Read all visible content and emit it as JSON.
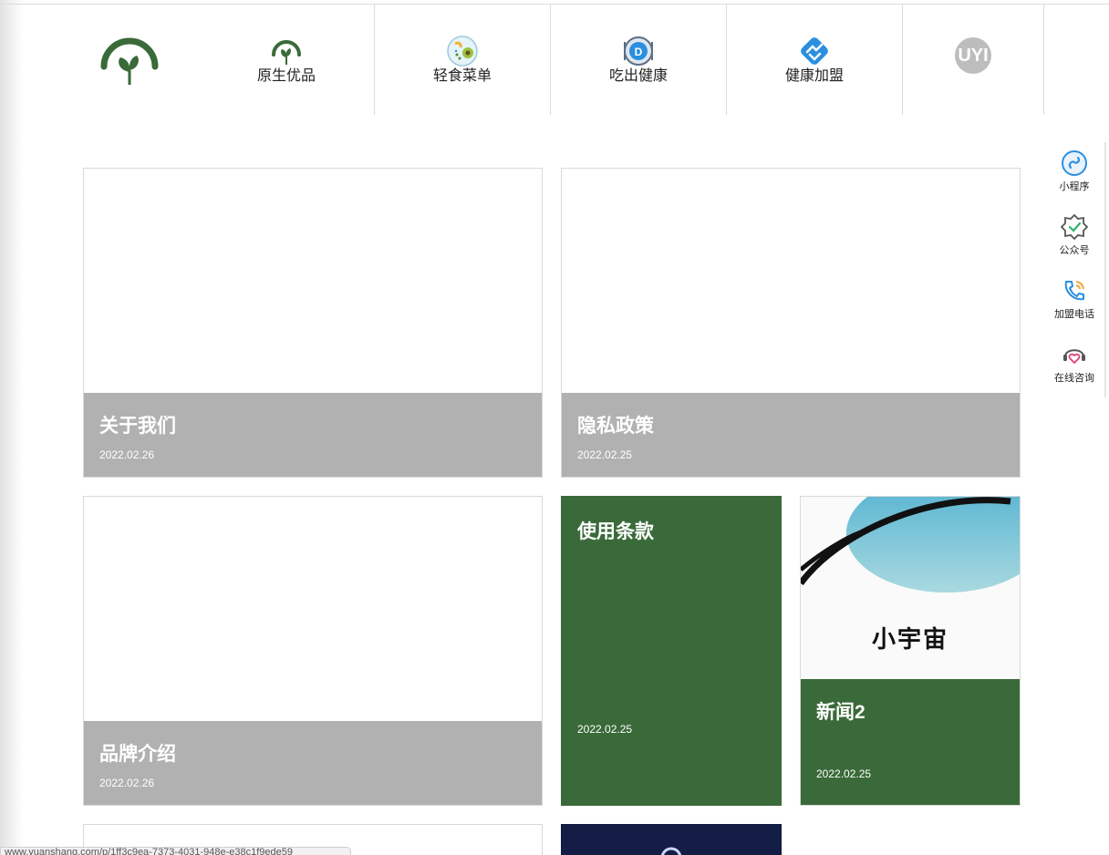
{
  "nav": {
    "items": [
      {
        "label": "原生优品",
        "icon": "leaf-logo-icon"
      },
      {
        "label": "轻食菜单",
        "icon": "salad-bowl-icon"
      },
      {
        "label": "吃出健康",
        "icon": "plate-fork-icon"
      },
      {
        "label": "健康加盟",
        "icon": "handshake-icon"
      }
    ],
    "avatar_text": "UYI"
  },
  "cards": [
    {
      "title": "关于我们",
      "date": "2022.02.26"
    },
    {
      "title": "隐私政策",
      "date": "2022.02.25"
    },
    {
      "title": "品牌介绍",
      "date": "2022.02.26"
    },
    {
      "title": "使用条款",
      "date": "2022.02.25"
    },
    {
      "title": "新闻2",
      "date": "2022.02.25",
      "image_text": "小宇宙"
    }
  ],
  "sidebar": {
    "items": [
      {
        "label": "小程序",
        "icon": "mini-program-icon"
      },
      {
        "label": "公众号",
        "icon": "verified-badge-icon"
      },
      {
        "label": "加盟电话",
        "icon": "phone-icon"
      },
      {
        "label": "在线咨询",
        "icon": "headset-heart-icon"
      }
    ]
  },
  "status_url": "www.yuanshang.com/p/1ff3c9ea-7373-4031-948e-e38c1f9ede59",
  "colors": {
    "brand_green": "#3a6a39",
    "caption_gray": "#b1b1b1",
    "accent_blue": "#2b8fe0"
  }
}
